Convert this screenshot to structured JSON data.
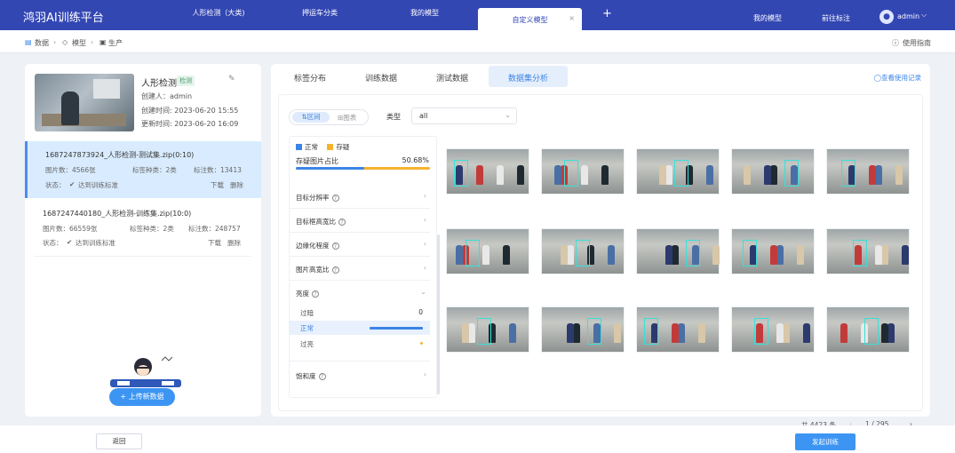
{
  "app": {
    "brand": "鸿羽AI训练平台"
  },
  "top_tabs": [
    {
      "label": "人形检测（大类)"
    },
    {
      "label": "押运车分类"
    },
    {
      "label": "我的模型"
    },
    {
      "label": "自定义模型",
      "active": true,
      "close": "×"
    }
  ],
  "top_right": {
    "plus": "+",
    "my_models": "我的模型",
    "goto_label": "前往标注",
    "user": "admin",
    "chevron": "⌵"
  },
  "breadcrumb": {
    "data": "数据",
    "model": "模型",
    "production": "生产",
    "help": "使用指南"
  },
  "model_card": {
    "title": "人形检测",
    "tag": "检测",
    "creator": "创建人：admin",
    "created": "创建时间:   2023-06-20 15:55",
    "updated": "更新时间:   2023-06-20 16:09"
  },
  "datasets": [
    {
      "name": "1687247873924_人形检测-测试集.zip(0:10)",
      "images": "图片数：4566张",
      "label_types": "标签种类：2类",
      "annotations": "标注数：13413",
      "status_label": "状态：",
      "status": "达到训练标准",
      "download": "下载",
      "delete": "删除"
    },
    {
      "name": "1687247440180_人形检测-训练集.zip(10:0)",
      "images": "图片数：66559张",
      "label_types": "标签种类：2类",
      "annotations": "标注数：248757",
      "status_label": "状态：",
      "status": "达到训练标准",
      "download": "下载",
      "delete": "删除"
    }
  ],
  "upload_button": "+ 上传新数据",
  "main_tabs": [
    "标签分布",
    "训练数据",
    "测试数据",
    "数据集分析"
  ],
  "history_link": "◯查看使用记录",
  "view_toggle": {
    "interval": "⇅区间",
    "chart": "⊞图表"
  },
  "type_filter": {
    "label": "类型",
    "value": "all"
  },
  "legend": {
    "normal": "正常",
    "doubt": "存疑",
    "normal_color": "#3b84e7",
    "doubt_color": "#f5b32d"
  },
  "doubt_ratio": {
    "label": "存疑图片占比",
    "value": "50.68%",
    "fraction": 0.5068
  },
  "filters": [
    "目标分辨率",
    "目标框高宽比",
    "边缘化程度",
    "图片高宽比",
    "亮度",
    "饱和度"
  ],
  "brightness": {
    "rows": [
      {
        "label": "过暗",
        "value": "0"
      },
      {
        "label": "正常"
      },
      {
        "label": "过亮"
      }
    ]
  },
  "pagination": {
    "total": "共 4423 条",
    "page": "1 / 295",
    "prev": "‹",
    "next": "›"
  },
  "bottom": {
    "back": "返回",
    "train": "发起训练"
  }
}
